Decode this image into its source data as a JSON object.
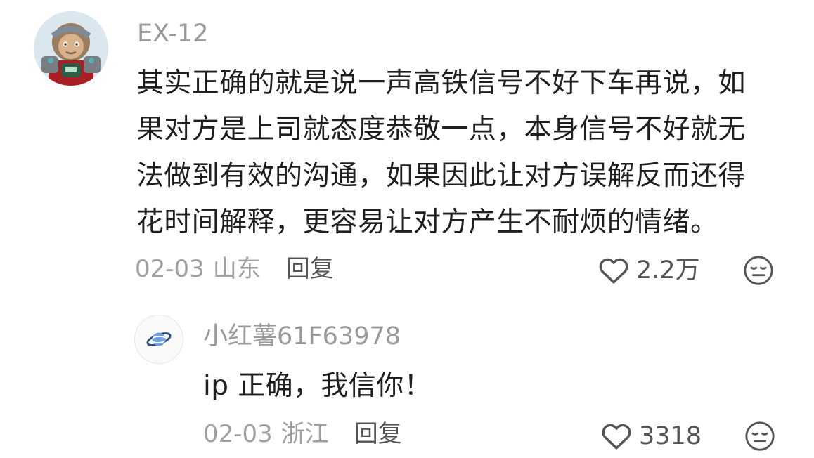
{
  "main_comment": {
    "username": "EX-12",
    "lines": [
      "其实正确的就是说一声高铁信号不好下车再说，如",
      "果对方是上司就态度恭敬一点，本身信号不好就无",
      "法做到有效的沟通，如果因此让对方误解反而还得",
      "花时间解释，更容易让对方产生不耐烦的情绪。"
    ],
    "date": "02-03",
    "location": "山东",
    "reply_label": "回复",
    "likes": "2.2万",
    "heart_icon": "heart-outline-icon",
    "reaction_icon": "neutral-face-icon"
  },
  "reply_comment": {
    "username": "小红薯61F63978",
    "text": "ip 正确，我信你！",
    "date": "02-03",
    "location": "浙江",
    "reply_label": "回复",
    "likes": "3318",
    "heart_icon": "heart-outline-icon",
    "reaction_icon": "neutral-face-icon"
  }
}
